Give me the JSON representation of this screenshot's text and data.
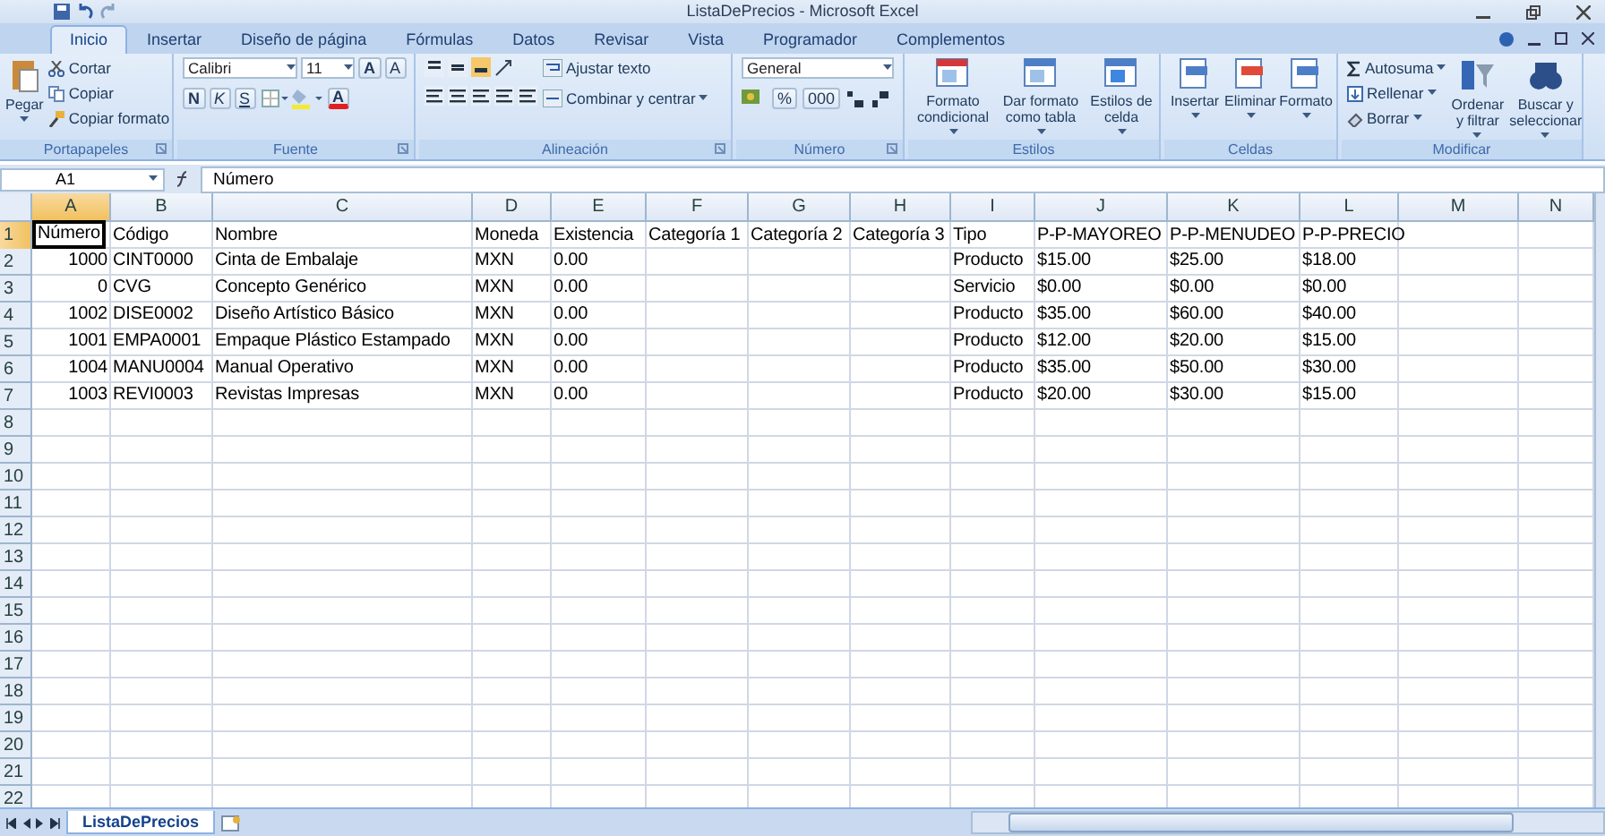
{
  "window": {
    "title": "ListaDePrecios - Microsoft Excel"
  },
  "tabs": [
    {
      "label": "Inicio",
      "selected": true
    },
    {
      "label": "Insertar",
      "selected": false
    },
    {
      "label": "Diseño de página",
      "selected": false
    },
    {
      "label": "Fórmulas",
      "selected": false
    },
    {
      "label": "Datos",
      "selected": false
    },
    {
      "label": "Revisar",
      "selected": false
    },
    {
      "label": "Vista",
      "selected": false
    },
    {
      "label": "Programador",
      "selected": false
    },
    {
      "label": "Complementos",
      "selected": false
    }
  ],
  "ribbon": {
    "clipboard": {
      "label": "Portapapeles",
      "paste": "Pegar",
      "cut": "Cortar",
      "copy": "Copiar",
      "format_painter": "Copiar formato"
    },
    "font": {
      "label": "Fuente",
      "font_name": "Calibri",
      "font_size": "11",
      "grow": "A",
      "shrink": "A",
      "bold": "N",
      "italic": "K",
      "underline": "S",
      "font_color": "A"
    },
    "alignment": {
      "label": "Alineación",
      "wrap_text": "Ajustar texto",
      "merge_center": "Combinar y centrar"
    },
    "number": {
      "label": "Número",
      "format": "General",
      "percent": "%",
      "thousands": "000"
    },
    "styles": {
      "label": "Estilos",
      "buttons": [
        "Formato condicional",
        "Dar formato como tabla",
        "Estilos de celda"
      ]
    },
    "cells": {
      "label": "Celdas",
      "buttons": [
        "Insertar",
        "Eliminar",
        "Formato"
      ]
    },
    "editing": {
      "label": "Modificar",
      "small": [
        "Autosuma",
        "Rellenar",
        "Borrar"
      ],
      "large": [
        "Ordenar y filtrar",
        "Buscar y seleccionar"
      ]
    }
  },
  "formula_bar": {
    "cell_ref": "A1",
    "value": "Número"
  },
  "sheet": {
    "columns": [
      {
        "label": "A",
        "kind": "number",
        "selected": true
      },
      {
        "label": "B",
        "kind": "text",
        "selected": false
      },
      {
        "label": "C",
        "kind": "text",
        "selected": false
      },
      {
        "label": "D",
        "kind": "text",
        "selected": false
      },
      {
        "label": "E",
        "kind": "text",
        "selected": false
      },
      {
        "label": "F",
        "kind": "text",
        "selected": false
      },
      {
        "label": "G",
        "kind": "text",
        "selected": false
      },
      {
        "label": "H",
        "kind": "text",
        "selected": false
      },
      {
        "label": "I",
        "kind": "text",
        "selected": false
      },
      {
        "label": "J",
        "kind": "text",
        "selected": false
      },
      {
        "label": "K",
        "kind": "text",
        "selected": false
      },
      {
        "label": "L",
        "kind": "text",
        "selected": false
      },
      {
        "label": "M",
        "kind": "text",
        "selected": false
      },
      {
        "label": "N",
        "kind": "text",
        "selected": false
      }
    ],
    "rows": [
      {
        "label": "1",
        "selected": true,
        "cells": [
          "Número",
          "Código",
          "Nombre",
          "Moneda",
          "Existencia",
          "Categoría 1",
          "Categoría 2",
          "Categoría 3",
          "Tipo",
          "P-P-MAYOREO",
          "P-P-MENUDEO",
          "P-P-PRECIO",
          null,
          null
        ]
      },
      {
        "label": "2",
        "selected": false,
        "cells": [
          "1000",
          "CINT0000",
          "Cinta de Embalaje",
          "MXN",
          "0.00",
          null,
          null,
          null,
          "Producto",
          "$15.00",
          "$25.00",
          "$18.00",
          null,
          null
        ]
      },
      {
        "label": "3",
        "selected": false,
        "cells": [
          "0",
          "CVG",
          "Concepto Genérico",
          "MXN",
          "0.00",
          null,
          null,
          null,
          "Servicio",
          "$0.00",
          "$0.00",
          "$0.00",
          null,
          null
        ]
      },
      {
        "label": "4",
        "selected": false,
        "cells": [
          "1002",
          "DISE0002",
          "Diseño Artístico Básico",
          "MXN",
          "0.00",
          null,
          null,
          null,
          "Producto",
          "$35.00",
          "$60.00",
          "$40.00",
          null,
          null
        ]
      },
      {
        "label": "5",
        "selected": false,
        "cells": [
          "1001",
          "EMPA0001",
          "Empaque Plástico Estampado",
          "MXN",
          "0.00",
          null,
          null,
          null,
          "Producto",
          "$12.00",
          "$20.00",
          "$15.00",
          null,
          null
        ]
      },
      {
        "label": "6",
        "selected": false,
        "cells": [
          "1004",
          "MANU0004",
          "Manual Operativo",
          "MXN",
          "0.00",
          null,
          null,
          null,
          "Producto",
          "$35.00",
          "$50.00",
          "$30.00",
          null,
          null
        ]
      },
      {
        "label": "7",
        "selected": false,
        "cells": [
          "1003",
          "REVI0003",
          "Revistas Impresas",
          "MXN",
          "0.00",
          null,
          null,
          null,
          "Producto",
          "$20.00",
          "$30.00",
          "$15.00",
          null,
          null
        ]
      },
      {
        "label": "8",
        "selected": false
      },
      {
        "label": "9",
        "selected": false
      },
      {
        "label": "10",
        "selected": false
      },
      {
        "label": "11",
        "selected": false
      },
      {
        "label": "12",
        "selected": false
      },
      {
        "label": "13",
        "selected": false
      },
      {
        "label": "14",
        "selected": false
      },
      {
        "label": "15",
        "selected": false
      },
      {
        "label": "16",
        "selected": false
      },
      {
        "label": "17",
        "selected": false
      },
      {
        "label": "18",
        "selected": false
      },
      {
        "label": "19",
        "selected": false
      },
      {
        "label": "20",
        "selected": false
      },
      {
        "label": "21",
        "selected": false
      },
      {
        "label": "22",
        "selected": false
      }
    ]
  },
  "sheet_tabs": [
    {
      "label": "ListaDePrecios",
      "selected": true
    }
  ]
}
